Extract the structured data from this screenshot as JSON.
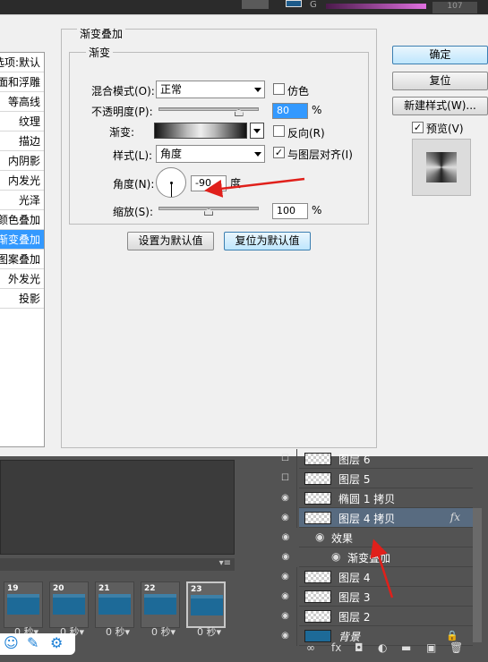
{
  "topbar": {
    "channel_label": "G",
    "channel_value": "107"
  },
  "dialog": {
    "left_list": [
      {
        "label": "混合选项:默认"
      },
      {
        "label": "斜面和浮雕"
      },
      {
        "label": "等高线"
      },
      {
        "label": "纹理"
      },
      {
        "label": "描边"
      },
      {
        "label": "内阴影"
      },
      {
        "label": "内发光"
      },
      {
        "label": "光泽"
      },
      {
        "label": "颜色叠加"
      },
      {
        "label": "渐变叠加",
        "selected": true
      },
      {
        "label": "图案叠加"
      },
      {
        "label": "外发光"
      },
      {
        "label": "投影"
      }
    ],
    "panel_title": "渐变叠加",
    "group_title": "渐变",
    "blend_mode_label": "混合模式(O):",
    "blend_mode_value": "正常",
    "dither_label": "仿色",
    "opacity_label": "不透明度(P):",
    "opacity_value": "80",
    "opacity_unit": "%",
    "opacity_level_percent": 80,
    "gradient_label": "渐变:",
    "reverse_label": "反向(R)",
    "style_label": "样式(L):",
    "style_value": "角度",
    "align_label": "与图层对齐(I)",
    "angle_label": "角度(N):",
    "angle_value": "-90",
    "angle_unit": "度",
    "scale_label": "缩放(S):",
    "scale_value": "100",
    "scale_unit": "%",
    "scale_level_percent": 50,
    "set_default_button": "设置为默认值",
    "reset_default_button": "复位为默认值",
    "ok_button": "确定",
    "reset_button": "复位",
    "new_style_button": "新建样式(W)...",
    "preview_label": "预览(V)"
  },
  "timeline": {
    "menu_glyph": "▾≡",
    "frames": [
      {
        "num": "19",
        "delay": "0 秒▾"
      },
      {
        "num": "20",
        "delay": "0 秒▾"
      },
      {
        "num": "21",
        "delay": "0 秒▾"
      },
      {
        "num": "22",
        "delay": "0 秒▾"
      },
      {
        "num": "23",
        "delay": "0 秒▾",
        "selected": true
      }
    ]
  },
  "layers": {
    "rows": [
      {
        "name": "图层 6",
        "visible": false
      },
      {
        "name": "图层 5",
        "visible": false
      },
      {
        "name": "椭圆 1 拷贝",
        "visible": true
      },
      {
        "name": "图层 4 拷贝",
        "visible": true,
        "selected": true,
        "fx": "fx"
      },
      {
        "name": "效果",
        "visible": true,
        "indent": 1
      },
      {
        "name": "渐变叠加",
        "visible": true,
        "indent": 2
      },
      {
        "name": "图层 4",
        "visible": true
      },
      {
        "name": "图层 3",
        "visible": true
      },
      {
        "name": "图层 2",
        "visible": true
      },
      {
        "name": "背景",
        "visible": true,
        "locked": true
      }
    ]
  },
  "colors": {
    "accent": "#3399ff",
    "annotation_arrow": "#e0201b",
    "selected_layer": "#586b80",
    "frame_thumb": "#1d6a98"
  }
}
